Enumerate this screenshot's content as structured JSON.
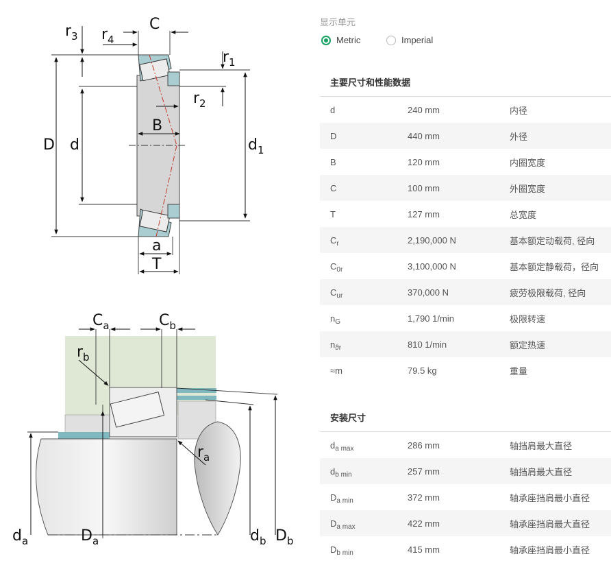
{
  "diagram_labels": {
    "top": {
      "r3": {
        "main": "r",
        "sub": "3"
      },
      "r4": {
        "main": "r",
        "sub": "4"
      },
      "C": "C",
      "r1": {
        "main": "r",
        "sub": "1"
      },
      "r2": {
        "main": "r",
        "sub": "2"
      },
      "D": "D",
      "d": "d",
      "B": "B",
      "d1": {
        "main": "d",
        "sub": "1"
      },
      "a": "a",
      "T": "T"
    },
    "bottom": {
      "Ca": {
        "main": "C",
        "sub": "a"
      },
      "Cb": {
        "main": "C",
        "sub": "b"
      },
      "rb": {
        "main": "r",
        "sub": "b"
      },
      "ra": {
        "main": "r",
        "sub": "a"
      },
      "da": {
        "main": "d",
        "sub": "a"
      },
      "Da": {
        "main": "D",
        "sub": "a"
      },
      "db": {
        "main": "d",
        "sub": "b"
      },
      "Db": {
        "main": "D",
        "sub": "b"
      }
    }
  },
  "units": {
    "title": "显示单元",
    "options": [
      {
        "label": "Metric",
        "selected": true
      },
      {
        "label": "Imperial",
        "selected": false
      }
    ]
  },
  "main_dims": {
    "title": "主要尺寸和性能数据",
    "rows": [
      {
        "sym": "d",
        "sub": "",
        "value": "240 mm",
        "desc": "内径"
      },
      {
        "sym": "D",
        "sub": "",
        "value": "440 mm",
        "desc": "外径"
      },
      {
        "sym": "B",
        "sub": "",
        "value": "120 mm",
        "desc": "内圈宽度"
      },
      {
        "sym": "C",
        "sub": "",
        "value": "100 mm",
        "desc": "外圈宽度"
      },
      {
        "sym": "T",
        "sub": "",
        "value": "127 mm",
        "desc": "总宽度"
      },
      {
        "sym": "C",
        "sub": "r",
        "value": "2,190,000 N",
        "desc": "基本额定动载荷, 径向"
      },
      {
        "sym": "C",
        "sub": "0r",
        "value": "3,100,000 N",
        "desc": "基本额定静载荷，径向"
      },
      {
        "sym": "C",
        "sub": "ur",
        "value": "370,000 N",
        "desc": "疲劳极限载荷, 径向"
      },
      {
        "sym": "n",
        "sub": "G",
        "value": "1,790 1/min",
        "desc": "极限转速"
      },
      {
        "sym": "n",
        "sub": "ϑr",
        "value": "810 1/min",
        "desc": "额定热速"
      },
      {
        "sym": "≈m",
        "sub": "",
        "value": "79.5 kg",
        "desc": "重量"
      }
    ]
  },
  "mount_dims": {
    "title": "安装尺寸",
    "rows": [
      {
        "sym": "d",
        "sub": "a max",
        "value": "286 mm",
        "desc": "轴挡肩最大直径"
      },
      {
        "sym": "d",
        "sub": "b min",
        "value": "257 mm",
        "desc": "轴挡肩最大直径"
      },
      {
        "sym": "D",
        "sub": "a min",
        "value": "372 mm",
        "desc": "轴承座挡肩最小直径"
      },
      {
        "sym": "D",
        "sub": "a max",
        "value": "422 mm",
        "desc": "轴承座挡肩最大直径"
      },
      {
        "sym": "D",
        "sub": "b min",
        "value": "415 mm",
        "desc": "轴承座挡肩最小直径"
      }
    ]
  },
  "colors": {
    "accent": "#1a9f62",
    "teal": "#7fb8bf",
    "green_bg": "#dfe8d4",
    "grey_body": "#d8d8d8"
  }
}
